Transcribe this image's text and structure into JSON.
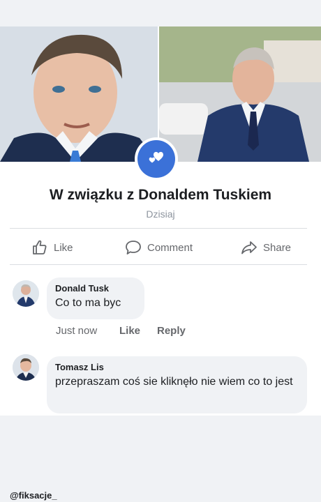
{
  "post": {
    "title": "W związku z Donaldem Tuskiem",
    "date": "Dzisiaj",
    "badge_icon": "hearts-icon",
    "accent": "#3b71d8"
  },
  "actions": {
    "like": "Like",
    "comment": "Comment",
    "share": "Share"
  },
  "comments": [
    {
      "author": "Donald Tusk",
      "text": "Co to ma byc",
      "time": "Just now",
      "like_label": "Like",
      "reply_label": "Reply"
    },
    {
      "author": "Tomasz Lis",
      "text": "przepraszam coś sie kliknęło nie wiem co to jest"
    }
  ],
  "watermark": "@fiksacje_"
}
